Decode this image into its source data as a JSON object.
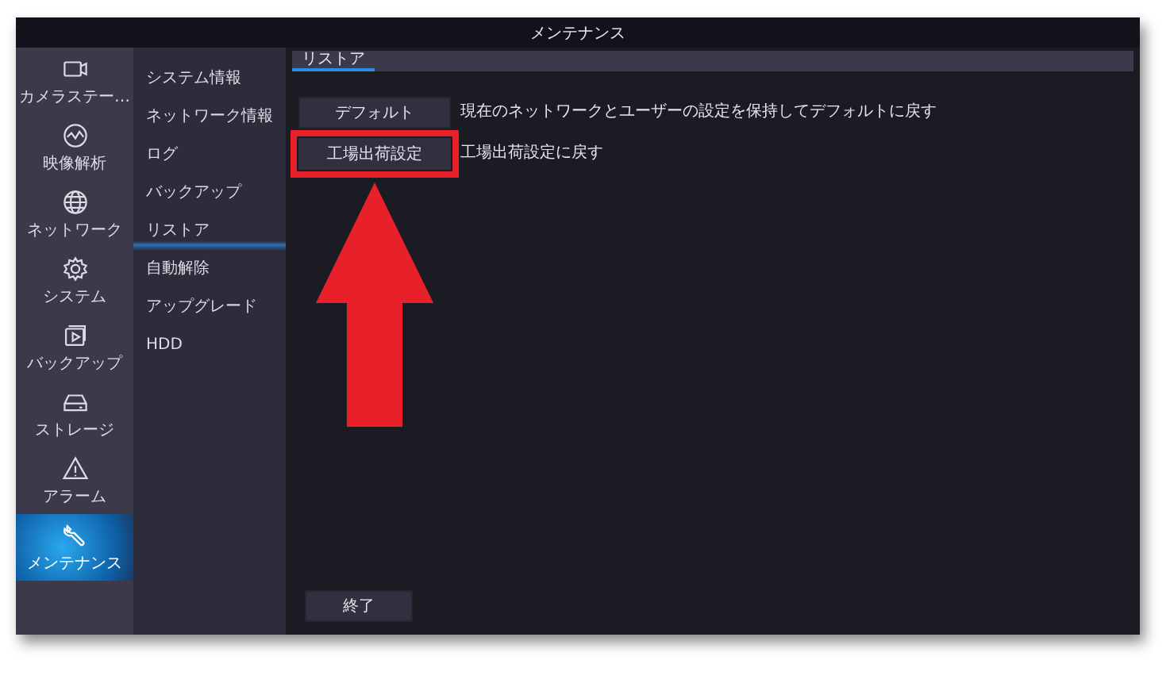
{
  "window": {
    "title": "メンテナンス"
  },
  "sidebar": {
    "items": [
      {
        "label": "カメラステー…",
        "selected": false
      },
      {
        "label": "映像解析",
        "selected": false
      },
      {
        "label": "ネットワーク",
        "selected": false
      },
      {
        "label": "システム",
        "selected": false
      },
      {
        "label": "バックアップ",
        "selected": false
      },
      {
        "label": "ストレージ",
        "selected": false
      },
      {
        "label": "アラーム",
        "selected": false
      },
      {
        "label": "メンテナンス",
        "selected": true
      }
    ]
  },
  "submenu": {
    "items": [
      {
        "label": "システム情報",
        "selected": false
      },
      {
        "label": "ネットワーク情報",
        "selected": false
      },
      {
        "label": "ログ",
        "selected": false
      },
      {
        "label": "バックアップ",
        "selected": false
      },
      {
        "label": "リストア",
        "selected": true
      },
      {
        "label": "自動解除",
        "selected": false
      },
      {
        "label": "アップグレード",
        "selected": false
      },
      {
        "label": "HDD",
        "selected": false
      }
    ]
  },
  "tabs": [
    {
      "label": "リストア",
      "selected": true
    }
  ],
  "actions": [
    {
      "button": "デフォルト",
      "description": "現在のネットワークとユーザーの設定を保持してデフォルトに戻す",
      "highlighted": false
    },
    {
      "button": "工場出荷設定",
      "description": "工場出荷設定に戻す",
      "highlighted": true
    }
  ],
  "exit_button": "終了"
}
